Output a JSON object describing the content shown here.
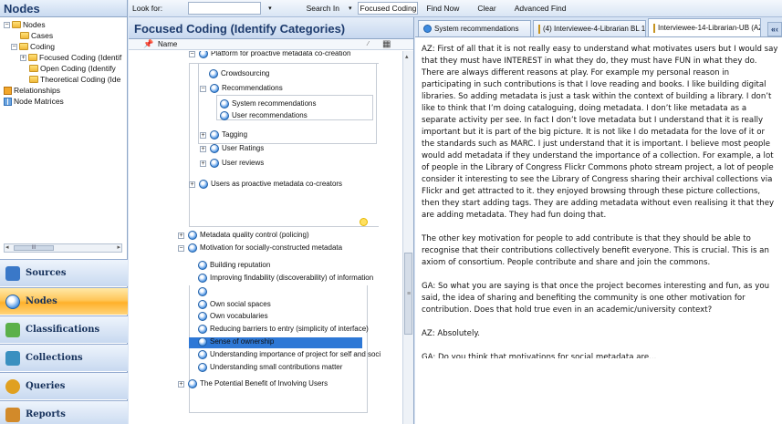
{
  "left_pane": {
    "title": "Nodes",
    "tree": [
      {
        "label": "Nodes",
        "icon": "folder-icon",
        "expander": "⊟"
      },
      {
        "label": "Cases",
        "icon": "folder-icon",
        "expander": ""
      },
      {
        "label": "Coding",
        "icon": "folder-icon",
        "expander": "⊟"
      },
      {
        "label": "Focused Coding (Identif",
        "icon": "folder-icon",
        "expander": "⊞"
      },
      {
        "label": "Open Coding (Identify",
        "icon": "folder-icon",
        "expander": ""
      },
      {
        "label": "Theoretical Coding (Ide",
        "icon": "folder-icon",
        "expander": ""
      },
      {
        "label": "Relationships",
        "icon": "relationship-icon",
        "expander": ""
      },
      {
        "label": "Node Matrices",
        "icon": "matrix-icon",
        "expander": ""
      }
    ],
    "scroll_grip": "III",
    "nav_buttons": [
      {
        "label": "Sources",
        "icon": "sources-icon",
        "color": "#3a78c8"
      },
      {
        "label": "Nodes",
        "icon": "nodes-icon",
        "color": "#3d8be0"
      },
      {
        "label": "Classifications",
        "icon": "classifications-icon",
        "color": "#5bb04a"
      },
      {
        "label": "Collections",
        "icon": "collections-icon",
        "color": "#3a90c0"
      },
      {
        "label": "Queries",
        "icon": "queries-icon",
        "color": "#e0a020"
      },
      {
        "label": "Reports",
        "icon": "reports-icon",
        "color": "#d28a2a"
      }
    ]
  },
  "toolbar": {
    "look_for_label": "Look for:",
    "look_for_value": "",
    "search_in_label": "Search In",
    "search_in_value": "Focused Coding (",
    "find_now": "Find Now",
    "clear": "Clear",
    "advanced_find": "Advanced Find"
  },
  "middle": {
    "title": "Focused Coding (Identify Categories)",
    "column_header": "Name",
    "rows": [
      {
        "label": "Platform for proactive metadata co-creation",
        "expander": "⊟"
      },
      {
        "label": "Crowdsourcing",
        "expander": ""
      },
      {
        "label": "Recommendations",
        "expander": "⊟"
      },
      {
        "label": "System recommendations",
        "expander": ""
      },
      {
        "label": "User recommendations",
        "expander": ""
      },
      {
        "label": "Tagging",
        "expander": "⊞"
      },
      {
        "label": "User Ratings",
        "expander": "⊞"
      },
      {
        "label": "User reviews",
        "expander": "⊞"
      },
      {
        "label": "Users as proactive metadata co-creators",
        "expander": "⊞"
      },
      {
        "label": "Metadata quality control (policing)",
        "expander": "⊞"
      },
      {
        "label": "Motivation for socially-constructed metadata",
        "expander": "⊟"
      },
      {
        "label": "Building reputation",
        "expander": ""
      },
      {
        "label": "Improving findability (discoverability) of information",
        "expander": ""
      },
      {
        "label": "Interestingness and fun",
        "expander": ""
      },
      {
        "label": "Own social spaces",
        "expander": ""
      },
      {
        "label": "Own vocabularies",
        "expander": ""
      },
      {
        "label": "Reducing barriers to entry (simplicity of interface)",
        "expander": ""
      },
      {
        "label": "Sense of ownership",
        "expander": ""
      },
      {
        "label": "Understanding importance of project for self and soci",
        "expander": ""
      },
      {
        "label": "Understanding small contributions matter",
        "expander": ""
      },
      {
        "label": "The Potential Benefit of Involving Users",
        "expander": "⊞"
      }
    ],
    "selected_row": "Interestingness and fun"
  },
  "right": {
    "tabs": [
      {
        "label": "System recommendations",
        "icon": "node-icon"
      },
      {
        "label": "(4) Interviewee-4-Librarian BL 1 (N",
        "icon": "document-icon"
      },
      {
        "label": "Interviewee-14-Librarian-UB (AZ)",
        "icon": "document-icon"
      }
    ],
    "tab_nav": "«‹",
    "paragraphs": [
      "AZ: First of all that it is not really easy to understand what motivates users but I would say that they must have INTEREST in what they do, they must have FUN in what they do. There are always different reasons at play. For example my personal reason in participating in such contributions is that I love reading and books.  I like building digital libraries. So adding metadata is just a task within the context of building a library. I don’t like to think that I’m doing cataloguing, doing metadata. I don’t like metadata as a separate activity per see. In fact I don’t love metadata but I understand that it is really important but it is part of the big picture. It is not like I do metadata for the love of it or the standards such as MARC. I just understand that it is important. I believe most people would add metadata if they understand the importance of a collection. For example, a lot of people in the Library of Congress Flickr Commons photo stream project, a lot of people consider it interesting to see the Library of Congress sharing their archival collections via Flickr and get attracted to it. they enjoyed browsing through these picture collections, then they start adding tags. They are adding metadata without even realising it that they are adding metadata. They had fun doing that.",
      "The other key motivation for people to add contribute is that they should be able to recognise that their contributions collectively benefit everyone. This is crucial. This is an axiom of consortium. People contribute and share and join the commons.",
      "GA: So what you are saying is that once the project becomes interesting and fun, as you said, the idea of sharing and benefiting  the community is one other motivation for contribution.   Does that hold true even in an academic/university context?",
      "AZ: Absolutely.",
      "GA: Do you think that motivations for social metadata are..."
    ]
  }
}
